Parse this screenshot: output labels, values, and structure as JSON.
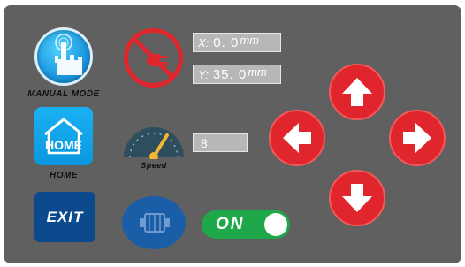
{
  "manual_mode": {
    "label": "MANUAL MODE",
    "icon": "hand-touch-icon"
  },
  "home": {
    "label": "HOME",
    "icon_text": "HOME",
    "icon": "home-icon"
  },
  "exit": {
    "label": "EXIT"
  },
  "stop_icon": "crossed-plug-icon",
  "coordinates": {
    "x": {
      "label": "X:",
      "value": "0. 0",
      "unit": "mm"
    },
    "y": {
      "label": "Y:",
      "value": "35. 0",
      "unit": "mm"
    }
  },
  "speed": {
    "label": "Speed",
    "value": "8",
    "icon": "speedometer-icon"
  },
  "motor_icon": "motor-icon",
  "toggle": {
    "label": "ON",
    "state": "on",
    "color": "#1fa84a"
  },
  "direction_pad": {
    "color": "#e0262c",
    "up": "arrow-up-icon",
    "left": "arrow-left-icon",
    "right": "arrow-right-icon",
    "down": "arrow-down-icon"
  }
}
